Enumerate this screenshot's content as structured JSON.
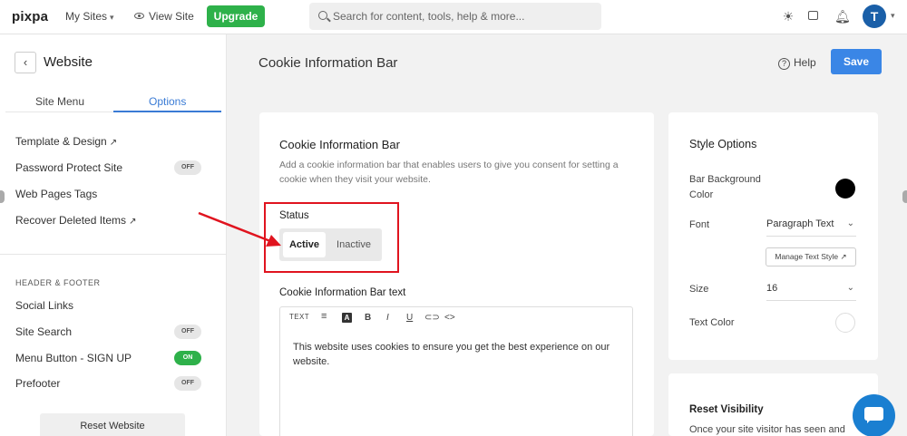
{
  "topbar": {
    "logo": "pixpa",
    "my_sites": "My Sites",
    "view_site": "View Site",
    "upgrade": "Upgrade",
    "search_placeholder": "Search for content, tools, help & more...",
    "avatar_letter": "T"
  },
  "sidebar": {
    "title": "Website",
    "tabs": [
      {
        "label": "Site Menu",
        "active": false
      },
      {
        "label": "Options",
        "active": true
      }
    ],
    "items": [
      {
        "label": "Template & Design"
      },
      {
        "label": "Password Protect Site",
        "toggle": "OFF"
      },
      {
        "label": "Web Pages Tags"
      },
      {
        "label": "Recover Deleted Items"
      }
    ],
    "section_header": "HEADER & FOOTER",
    "section_items": [
      {
        "label": "Social Links"
      },
      {
        "label": "Site Search",
        "toggle": "OFF"
      },
      {
        "label": "Menu Button - SIGN UP",
        "toggle": "ON"
      },
      {
        "label": "Prefooter",
        "toggle": "OFF"
      }
    ],
    "reset_button": "Reset Website"
  },
  "header": {
    "title": "Cookie Information Bar",
    "help": "Help",
    "save": "Save"
  },
  "main_card": {
    "title": "Cookie Information Bar",
    "description": "Add a cookie information bar that enables users to give you consent for setting a cookie when they visit your website.",
    "status_label": "Status",
    "status_options": [
      "Active",
      "Inactive"
    ],
    "status_selected": "Active",
    "text_label": "Cookie Information Bar text",
    "toolbar_text": "TEXT",
    "toolbar_color": "A",
    "toolbar_bold": "B",
    "toolbar_italic": "I",
    "toolbar_underline": "U",
    "editor_content": "This website uses cookies to ensure you get the best experience on our website."
  },
  "style_card": {
    "title": "Style Options",
    "bar_bg_label": "Bar Background Color",
    "bar_bg_color": "#000000",
    "font_label": "Font",
    "font_value": "Paragraph Text",
    "manage_text_style": "Manage Text Style",
    "size_label": "Size",
    "size_value": "16",
    "text_color_label": "Text Color",
    "text_color": "#ffffff"
  },
  "reset_card": {
    "title": "Reset Visibility",
    "description": "Once your site visitor has seen and"
  },
  "colors": {
    "accent": "#3a86e6",
    "upgrade_green": "#2eb14a",
    "annotation_red": "#e0141f"
  }
}
